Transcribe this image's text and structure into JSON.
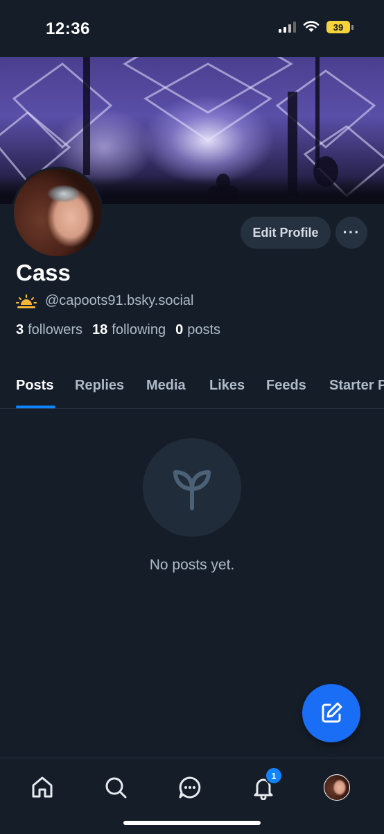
{
  "status_bar": {
    "time": "12:36",
    "battery": "39"
  },
  "profile": {
    "name": "Cass",
    "handle_icon": "sunrise-emoji",
    "handle": "@capoots91.bsky.social",
    "edit_button": "Edit Profile",
    "more_button": "···",
    "stats": [
      {
        "count": "3",
        "label": "followers"
      },
      {
        "count": "18",
        "label": "following"
      },
      {
        "count": "0",
        "label": "posts"
      }
    ]
  },
  "tabs": [
    "Posts",
    "Replies",
    "Media",
    "Likes",
    "Feeds",
    "Starter Packs"
  ],
  "active_tab": "Posts",
  "empty_state": {
    "icon": "sprout-icon",
    "text": "No posts yet."
  },
  "fab": {
    "icon": "compose-icon"
  },
  "bottom_nav": {
    "items": [
      "home-icon",
      "search-icon",
      "chat-icon",
      "bell-icon",
      "profile-avatar"
    ],
    "notification_badge": "1"
  },
  "colors": {
    "accent": "#1083fe",
    "fab": "#1a6df5",
    "background": "#151d28",
    "muted_text": "#aebbc9",
    "button_bg": "#263140"
  }
}
